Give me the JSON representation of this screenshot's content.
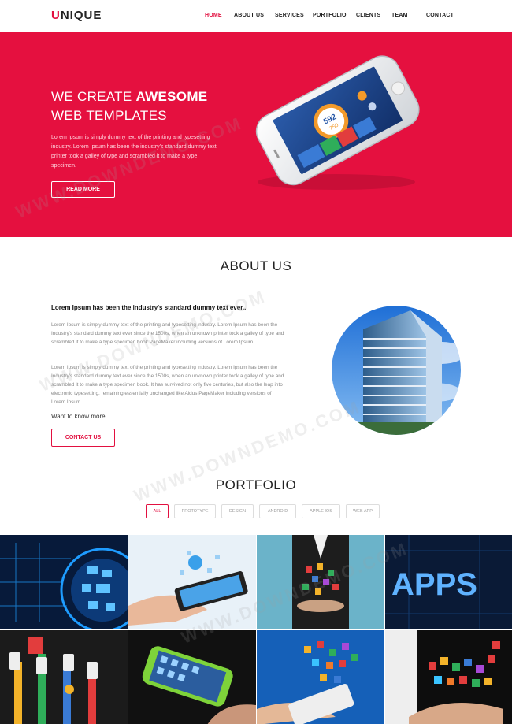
{
  "brand": {
    "logo_first": "U",
    "logo_rest": "NIQUE"
  },
  "nav": {
    "items": [
      "HOME",
      "ABOUT US",
      "SERVICES",
      "PORTFOLIO",
      "CLIENTS",
      "TEAM",
      "CONTACT"
    ],
    "active": "HOME"
  },
  "hero": {
    "title_line1_light": "WE CREATE ",
    "title_line1_bold": "AWESOME",
    "title_line2": "WEB TEMPLATES",
    "description": "Lorem Ipsum is simply dummy text of the printing and typesetting industry. Lorem Ipsum has been the industry's standard dummy text printer took a galley of type and scrambled it to make a type specimen.",
    "button": "READ MORE",
    "phone_readout_top": "592",
    "phone_readout_bottom": "750"
  },
  "about": {
    "title": "ABOUT US",
    "lead": "Lorem Ipsum has been the industry's standard dummy text ever..",
    "para1": "Lorem Ipsum is simply dummy text of the printing and typesetting industry. Lorem Ipsum has been the Industry's standard dummy text ever since the 1500s, when an unknown printer took a galley of type and scrambled it to make a type specimen book.PageMaker including versions of Lorem Ipsum.",
    "para2": "Lorem Ipsum is simply dummy text of the printing and typesetting industry. Lorem Ipsum has been the Industry's standard dummy text ever since the 1500s, when an unknown printer took a galley of type and scrambled it to make a type specimen book. It has survived not only five centuries, but also the leap into electronic typesetting, remaining essentially unchanged like Aldus PageMaker including versions of Lorem Ipsum.",
    "want_more": "Want to know more..",
    "button": "CONTACT US"
  },
  "portfolio": {
    "title": "PORTFOLIO",
    "filters": [
      "ALL",
      "PROTOTYPE",
      "DESIGN",
      "ANDROID",
      "APPLE IOS",
      "WEB APP"
    ],
    "active_filter": "ALL",
    "apps_word": "APPS"
  },
  "watermark": "WWW.DOWNDEMO.COM",
  "colors": {
    "accent": "#e5103f",
    "text": "#222222"
  }
}
